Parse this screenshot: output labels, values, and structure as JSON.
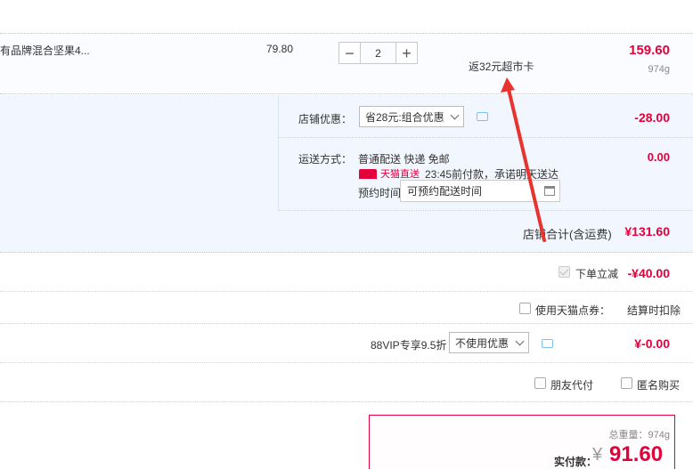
{
  "product": {
    "name": "有品牌混合坚果4...",
    "unit_price": "79.80",
    "quantity": "2",
    "minus": "−",
    "plus": "+",
    "subtotal": "159.60",
    "weight": "974g",
    "cashback_note": "返32元超市卡"
  },
  "shop": {
    "coupon_label": "店铺优惠：",
    "coupon_selected": "省28元:组合优惠",
    "coupon_amount": "-28.00",
    "shipping_label": "运送方式：",
    "shipping_method": "普通配送 快递 免邮",
    "shipping_amount": "0.00",
    "tmall_badge": "天猫直送",
    "promise": "23:45前付款，承诺明天送达",
    "reserve_label": "预约时间",
    "reserve_placeholder": "可预约配送时间",
    "total_label": "店铺合计(含运费)",
    "total_value": "¥131.60"
  },
  "discounts": {
    "instant_label": "下单立减",
    "instant_value": "-¥40.00",
    "points_label": "使用天猫点券：",
    "points_note": "结算时扣除",
    "vip_label": "88VIP专享9.5折",
    "vip_selected": "不使用优惠",
    "vip_value": "¥-0.00",
    "friend_pay": "朋友代付",
    "anonymous": "匿名购买"
  },
  "summary": {
    "weight_label": "总重量：974g",
    "pay_label": "实付款：",
    "currency": "¥",
    "pay_value": "91.60"
  },
  "colors": {
    "accent_red": "#e4003a",
    "annotation_arrow": "#e8342f"
  }
}
